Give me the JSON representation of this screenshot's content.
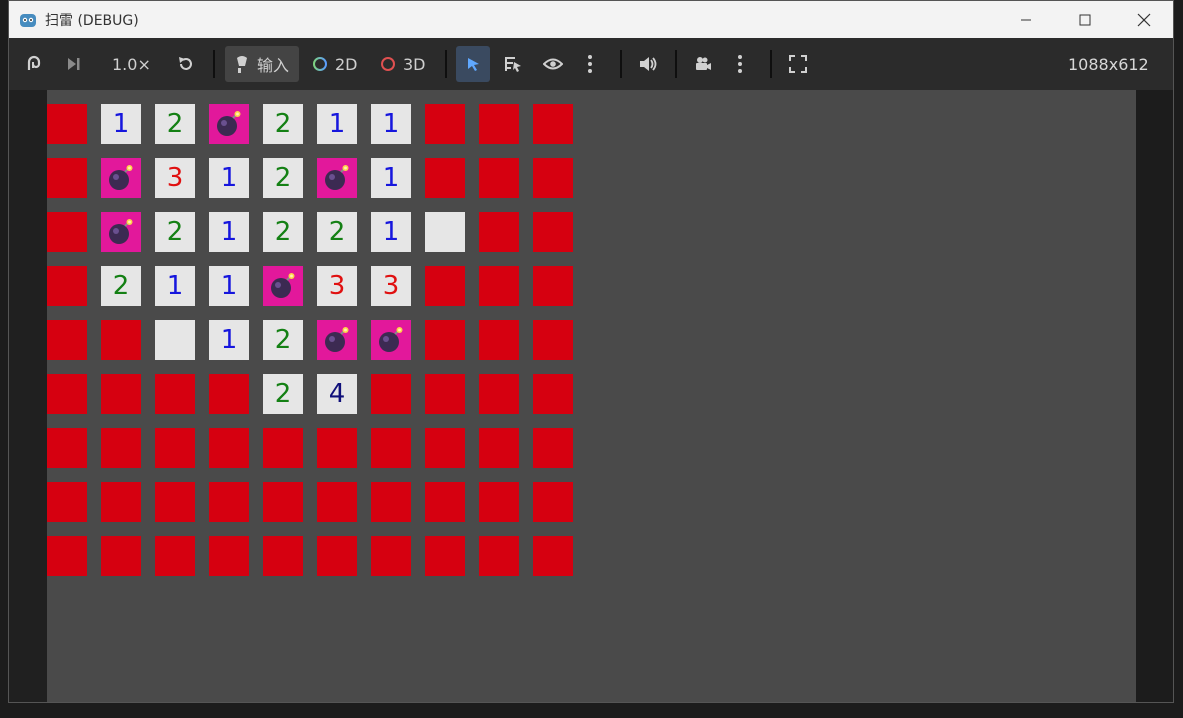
{
  "window": {
    "title": "扫雷 (DEBUG)"
  },
  "toolbar": {
    "speed_label": "1.0×",
    "input_label": "输入",
    "label_2d": "2D",
    "label_3d": "3D",
    "resolution": "1088x612"
  },
  "colors": {
    "hidden": "#d60010",
    "revealed": "#e6e6e6",
    "mine": "#e2189b",
    "n1": "#1616dd",
    "n2": "#148014",
    "n3": "#e01010",
    "n4": "#10107a"
  },
  "board": {
    "rows": [
      [
        "H",
        "E",
        "H",
        "H",
        "H",
        "H",
        "H",
        "H",
        "H",
        "H"
      ],
      [
        "H",
        "1",
        "2",
        "M",
        "2",
        "1",
        "1",
        "H",
        "H",
        "H"
      ],
      [
        "H",
        "M",
        "3",
        "1",
        "2",
        "M",
        "1",
        "H",
        "H",
        "H"
      ],
      [
        "H",
        "M",
        "2",
        "1",
        "2",
        "2",
        "1",
        "E",
        "H",
        "H"
      ],
      [
        "H",
        "2",
        "1",
        "1",
        "M",
        "3",
        "3",
        "H",
        "H",
        "H"
      ],
      [
        "H",
        "H",
        "E",
        "1",
        "2",
        "M",
        "M",
        "H",
        "H",
        "H"
      ],
      [
        "H",
        "H",
        "H",
        "H",
        "2",
        "4",
        "H",
        "H",
        "H",
        "H"
      ],
      [
        "H",
        "H",
        "H",
        "H",
        "H",
        "H",
        "H",
        "H",
        "H",
        "H"
      ],
      [
        "H",
        "H",
        "H",
        "H",
        "H",
        "H",
        "H",
        "H",
        "H",
        "H"
      ],
      [
        "H",
        "H",
        "H",
        "H",
        "H",
        "H",
        "H",
        "H",
        "H",
        "H"
      ]
    ]
  }
}
